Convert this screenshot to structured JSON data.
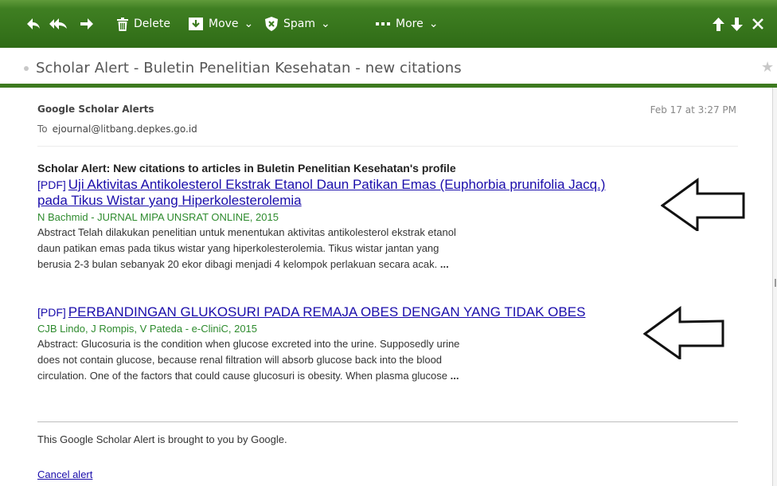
{
  "toolbar": {
    "icons": [
      "reply-icon",
      "reply-all-icon",
      "forward-icon",
      "trash-icon",
      "move-icon",
      "shield-icon",
      "more-dots-icon",
      "up-arrow-icon",
      "down-arrow-icon",
      "close-icon"
    ],
    "delete_label": "Delete",
    "move_label": "Move",
    "spam_label": "Spam",
    "more_label": "More",
    "caret": "⌄"
  },
  "subject": "Scholar Alert - Buletin Penelitian Kesehatan - new citations",
  "header": {
    "sender": "Google Scholar Alerts",
    "date": "Feb 17 at 3:27 PM",
    "to_label": "To",
    "to_address": "ejournal@litbang.depkes.go.id"
  },
  "body": {
    "alert_heading": "Scholar Alert: New citations to articles in Buletin Penelitian Kesehatan's profile",
    "articles": [
      {
        "tag": "[PDF]",
        "title_line1": "Uji Aktivitas Antikolesterol Ekstrak Etanol Daun Patikan Emas (Euphorbia prunifolia Jacq.)",
        "title_line2": "pada Tikus Wistar yang Hiperkolesterolemia",
        "authors": "N Bachmid - JURNAL MIPA UNSRAT ONLINE, 2015",
        "abstract_lines": [
          "Abstract Telah dilakukan penelitian untuk menentukan aktivitas antikolesterol ekstrak etanol",
          "daun patikan emas pada tikus wistar yang hiperkolesterolemia. Tikus wistar jantan yang",
          "berusia 2-3 bulan sebanyak 20 ekor dibagi menjadi 4 kelompok perlakuan secara acak."
        ],
        "ellipsis": "..."
      },
      {
        "tag": "[PDF]",
        "title_line1": "PERBANDINGAN GLUKOSURI PADA REMAJA OBES DENGAN YANG TIDAK OBES",
        "authors": "CJB Lindo, J Rompis, V Pateda - e-CliniC, 2015",
        "abstract_lines": [
          "Abstract: Glucosuria is the condition when glucose excreted into the urine. Supposedly urine",
          "does not contain glucose, because renal filtration will absorb glucose back into the blood",
          "circulation. One of the factors that could cause glucosuri is obesity. When plasma glucose"
        ],
        "ellipsis": "..."
      }
    ],
    "footer_text": "This Google Scholar Alert is brought to you by Google.",
    "cancel_label": "Cancel alert"
  },
  "colors": {
    "toolbar_green": "#2f6b16",
    "link_blue": "#1a0dab",
    "author_green": "#2e8b2e",
    "rule_green": "#3d7a1f"
  }
}
